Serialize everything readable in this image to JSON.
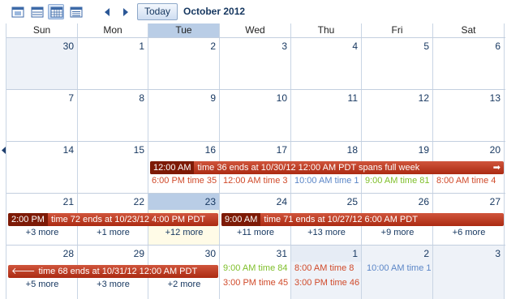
{
  "toolbar": {
    "views": [
      {
        "icon": "day-view-icon"
      },
      {
        "icon": "week-view-icon"
      },
      {
        "icon": "month-view-icon",
        "active": true
      },
      {
        "icon": "agenda-view-icon"
      }
    ],
    "today_label": "Today",
    "period_title": "October 2012"
  },
  "colors": {
    "event_bar": "#b8351c",
    "event_bar_time": "#7d1a06",
    "red_text": "#d04a2a",
    "blue_text": "#5b86c7",
    "green_text": "#7fbf2a",
    "today_header": "#b9cde6"
  },
  "day_names": [
    "Sun",
    "Mon",
    "Tue",
    "Wed",
    "Thu",
    "Fri",
    "Sat"
  ],
  "weeks": [
    {
      "days": [
        "30",
        "1",
        "2",
        "3",
        "4",
        "5",
        "6"
      ]
    },
    {
      "days": [
        "7",
        "8",
        "9",
        "10",
        "11",
        "12",
        "13"
      ]
    },
    {
      "days": [
        "14",
        "15",
        "16",
        "17",
        "18",
        "19",
        "20"
      ],
      "bar": {
        "time": "12:00 AM",
        "text": "time 36 ends at 10/30/12 12:00 AM PDT spans full week",
        "arrow": "➡"
      },
      "events": [
        {
          "text": "6:00 PM time 35"
        },
        {
          "text": "12:00 AM time 3"
        },
        {
          "text": "10:00 AM time 1"
        },
        {
          "text": "9:00 AM time 81"
        },
        {
          "text": "8:00 AM time 4"
        }
      ]
    },
    {
      "days": [
        "21",
        "22",
        "23",
        "24",
        "25",
        "26",
        "27"
      ],
      "bars": [
        {
          "time": "2:00 PM",
          "text": "time 72 ends at 10/23/12 4:00 PM PDT"
        },
        {
          "time": "9:00 AM",
          "text": "time 71 ends at 10/27/12 6:00 AM PDT"
        }
      ],
      "more": [
        "+3 more",
        "+1 more",
        "+12 more",
        "+11 more",
        "+13 more",
        "+9 more",
        "+6 more"
      ]
    },
    {
      "days": [
        "28",
        "29",
        "30",
        "31",
        "1",
        "2",
        "3"
      ],
      "bar": {
        "arrow": "🡐",
        "text": "time 68 ends at 10/31/12 12:00 AM PDT"
      },
      "events": [
        {
          "text": "9:00 AM time 84"
        },
        {
          "text": "8:00 AM time 8"
        },
        {
          "text": "10:00 AM time 1"
        },
        {
          "text": "3:00 PM time 45"
        },
        {
          "text": "3:00 PM time 46"
        }
      ],
      "more": [
        "+5 more",
        "+3 more",
        "+2 more"
      ]
    }
  ]
}
